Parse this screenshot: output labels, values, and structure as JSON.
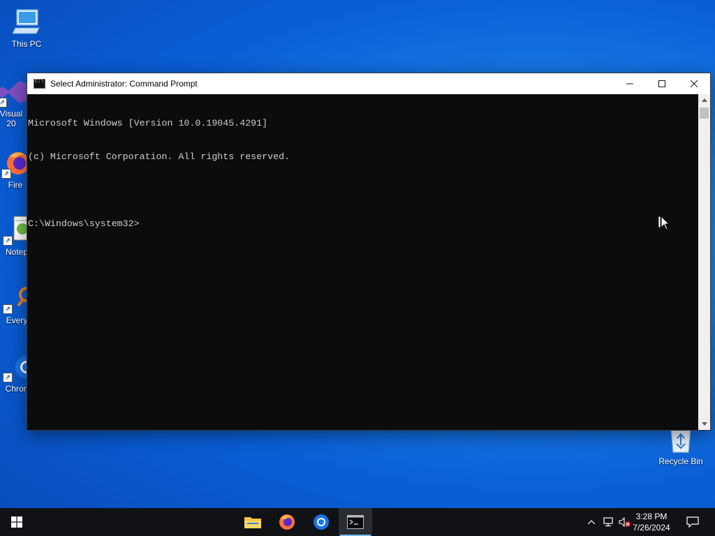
{
  "desktop": {
    "icons": [
      {
        "label": "This PC"
      },
      {
        "label": "Visual\n20"
      },
      {
        "label": "Fire"
      },
      {
        "label": "Notep"
      },
      {
        "label": "Every"
      },
      {
        "label": "Chron"
      },
      {
        "label": "Recycle Bin"
      }
    ]
  },
  "window": {
    "title": "Select Administrator: Command Prompt",
    "console_lines": [
      "Microsoft Windows [Version 10.0.19045.4291]",
      "(c) Microsoft Corporation. All rights reserved.",
      "",
      "C:\\Windows\\system32>"
    ]
  },
  "taskbar": {
    "clock_time": "3:28 PM",
    "clock_date": "7/26/2024"
  },
  "colors": {
    "accent": "#76b9ed",
    "console_bg": "#0c0c0c",
    "console_fg": "#cccccc",
    "taskbar_bg": "#101216"
  }
}
